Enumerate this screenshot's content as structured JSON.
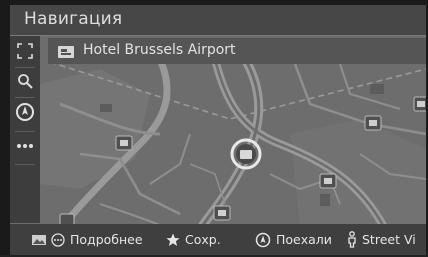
{
  "header": {
    "title": "Навигация"
  },
  "destination": {
    "name": "Hotel Brussels Airport",
    "icon": "hotel-icon"
  },
  "sidebar": {
    "buttons": [
      {
        "icon": "expand-icon"
      },
      {
        "icon": "search-icon"
      },
      {
        "icon": "compass-icon"
      },
      {
        "icon": "more-icon"
      }
    ]
  },
  "bottom_bar": {
    "info_label": "Подробнее",
    "save_label": "Сохр.",
    "go_label": "Поехали",
    "street_label": "Street Vi"
  },
  "colors": {
    "map_bg": "#6d6d6d",
    "road": "#909090",
    "bar": "#3f3f3f",
    "text": "#e6e6e6"
  }
}
